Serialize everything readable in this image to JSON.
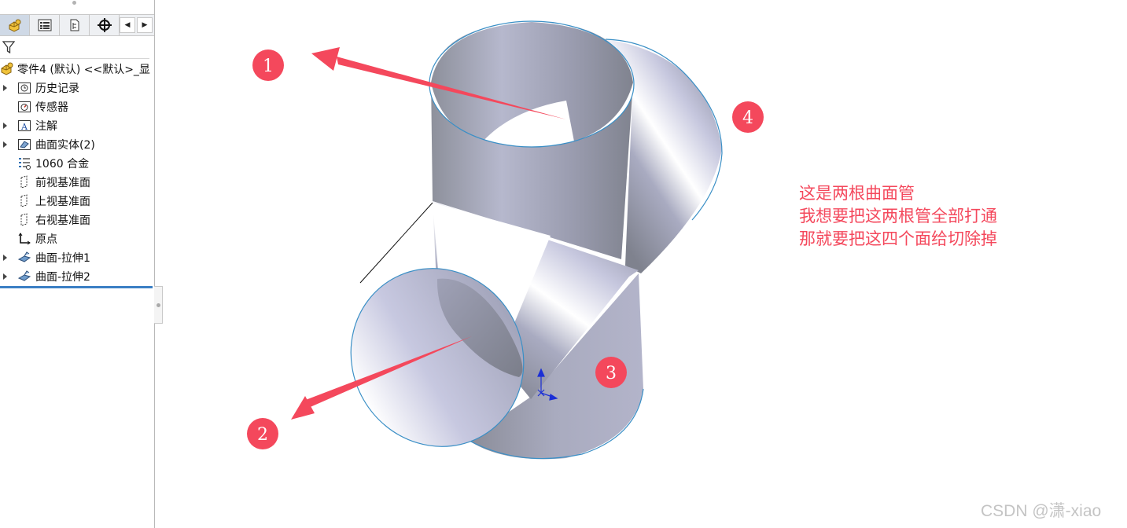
{
  "feature_tree": {
    "tabs": [
      {
        "icon": "part-feature-manager-icon",
        "active": true
      },
      {
        "icon": "property-manager-icon",
        "active": false
      },
      {
        "icon": "configuration-manager-icon",
        "active": false
      },
      {
        "icon": "dimxpert-manager-icon",
        "active": false
      }
    ],
    "scroll_left": "◀",
    "scroll_right": "▶",
    "filter_icon": "filter-icon",
    "root": {
      "label": "零件4 (默认) <<默认>_显",
      "icon": "part-icon"
    },
    "items": [
      {
        "label": "历史记录",
        "icon": "history-icon",
        "expandable": true
      },
      {
        "label": "传感器",
        "icon": "sensor-icon",
        "expandable": false
      },
      {
        "label": "注解",
        "icon": "annotation-icon",
        "expandable": true
      },
      {
        "label": "曲面实体(2)",
        "icon": "surface-bodies-icon",
        "expandable": true
      },
      {
        "label": "1060 合金",
        "icon": "material-icon",
        "expandable": false
      },
      {
        "label": "前视基准面",
        "icon": "plane-icon",
        "expandable": false
      },
      {
        "label": "上视基准面",
        "icon": "plane-icon",
        "expandable": false
      },
      {
        "label": "右视基准面",
        "icon": "plane-icon",
        "expandable": false
      },
      {
        "label": "原点",
        "icon": "origin-icon",
        "expandable": false
      },
      {
        "label": "曲面-拉伸1",
        "icon": "surface-extrude-icon",
        "expandable": true
      },
      {
        "label": "曲面-拉伸2",
        "icon": "surface-extrude-icon",
        "expandable": true
      }
    ]
  },
  "viewport": {
    "badges": [
      "1",
      "2",
      "3",
      "4"
    ],
    "note_lines": [
      "这是两根曲面管",
      "我想要把这两根管全部打通",
      "那就要把这四个面给切除掉"
    ],
    "watermark": "CSDN @潇-xiao",
    "colors": {
      "annotation": "#f4485c",
      "surface_light": "#c3c4dc",
      "surface_dark": "#80838f",
      "edge": "#3a8fc6",
      "tree_accent": "#3b7fc4"
    }
  }
}
